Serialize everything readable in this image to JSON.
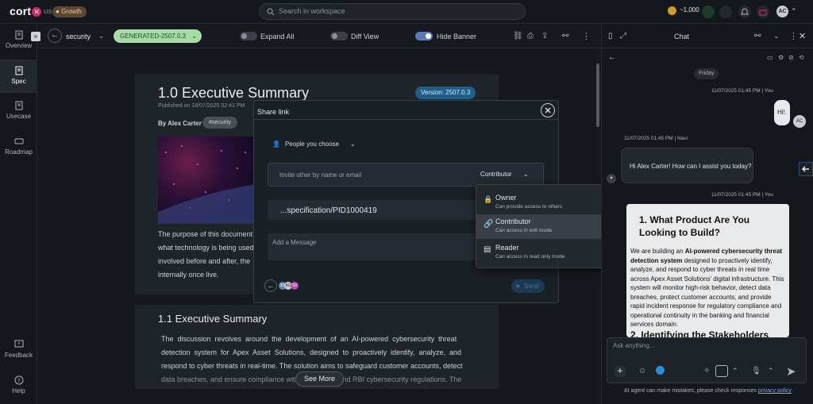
{
  "topbar": {
    "logo": "cort",
    "logo_region": "US",
    "plan_badge": "Growth",
    "search_placeholder": "Search in workspace",
    "credits": "~1,000",
    "user_initials": "AC"
  },
  "nav": {
    "items": [
      {
        "label": "Overview"
      },
      {
        "label": "Spec"
      },
      {
        "label": "Usecase"
      },
      {
        "label": "Roadmap"
      }
    ],
    "bottom": [
      {
        "label": "Feedback"
      },
      {
        "label": "Help"
      }
    ]
  },
  "toolbar": {
    "project": "security",
    "version_tag": "GENERATED-2507.0.3",
    "expand_all": "Expand All",
    "diff_view": "Diff View",
    "hide_banner": "Hide Banner"
  },
  "document": {
    "title": "1.0 Executive Summary",
    "version": "Version: 2507.0.3",
    "published": "Published on 18/07/2025 02:41 PM",
    "author": "By Alex Carter",
    "tag": "#security",
    "para_lines": [
      "The purpose of this document",
      "what technology is being used",
      "involved before and after, the",
      "internally once live."
    ],
    "section_title": "1.1 Executive Summary",
    "section_lines": [
      "The  discussion  revolves  around  the  development  of  an  AI-powered  cybersecurity  threat",
      "detection  system  for  Apex  Asset  Solutions,  designed  to  proactively  identify,  analyze,  and",
      "respond to cyber threats in real-time. The solution aims to safeguard customer accounts, detect",
      "data breaches, and ensure compliance with                    and RBI cybersecurity regulations. The"
    ],
    "see_more": "See More"
  },
  "share_modal": {
    "title": "Share link",
    "people_label": "People you choose",
    "invite_placeholder": "Invite other by name or email",
    "role_selected": "Contributor",
    "link_text": "...specification/PID1000419",
    "message_placeholder": "Add a Message",
    "avatars": [
      "SS",
      "AC",
      "S2"
    ],
    "send": "Send"
  },
  "role_dropdown": {
    "options": [
      {
        "title": "Owner",
        "desc": "Can provide access to others"
      },
      {
        "title": "Contributor",
        "desc": "Can access in edit mode"
      },
      {
        "title": "Reader",
        "desc": "Can access in read only mode"
      }
    ]
  },
  "chat": {
    "title": "Chat",
    "day": "Friday",
    "user_meta": "11/07/2025 01:45 PM | You",
    "user_msg": "Hi!.",
    "user_initials": "AC",
    "ai_meta": "11/07/2025 01:45 PM | Navi",
    "ai_msg": "Hi Alex Carter! How can I assist you today?",
    "user_meta2": "11/07/2025 01:45 PM | You",
    "card_title": "1. What Product Are You Looking to Build?",
    "card_body_1": "We are building an ",
    "card_body_bold": "AI-powered cybersecurity threat detection system",
    "card_body_2": " designed to proactively identify, analyze, and respond to cyber threats in real time across Apex Asset Solutions' digital infrastructure. This system will monitor high-risk behavior, detect data breaches, protect customer accounts, and provide rapid incident response for regulatory compliance and operational continuity in the banking and financial services domain.",
    "card_h2": "2. Identifying the Stakeholders",
    "input_placeholder": "Ask anything...",
    "disclaimer": "AI agent can make mistakes, please check responses",
    "privacy": "privacy policy"
  }
}
